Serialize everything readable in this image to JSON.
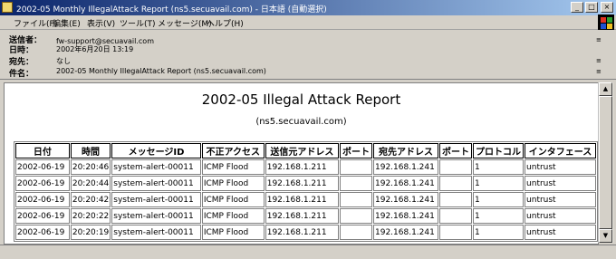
{
  "window": {
    "title": "2002-05 Monthly IllegalAttack Report (ns5.secuavail.com) - 日本語 (自動選択)"
  },
  "menu": [
    "ファイル(F)",
    "編集(E)",
    "表示(V)",
    "ツール(T)",
    "メッセージ(M)",
    "ヘルプ(H)"
  ],
  "header": {
    "from_label": "送信者：",
    "from": "fw-support@secuavail.com",
    "date_label": "日時：",
    "date": "2002年6月20日 13:19",
    "to_label": "宛先：",
    "to": "なし",
    "subject_label": "件名：",
    "subject": "2002-05 Monthly IllegalAttack Report (ns5.secuavail.com)"
  },
  "report": {
    "title": "2002-05 Illegal Attack Report",
    "subtitle": "(ns5.secuavail.com)",
    "columns": [
      "日付",
      "時間",
      "メッセージID",
      "不正アクセス",
      "送信元アドレス",
      "ポート",
      "宛先アドレス",
      "ポート",
      "プロトコル",
      "インタフェース"
    ],
    "rows": [
      [
        "2002-06-19",
        "20:20:46",
        "system-alert-00011",
        "ICMP Flood",
        "192.168.1.211",
        "",
        "192.168.1.241",
        "",
        "1",
        "untrust"
      ],
      [
        "2002-06-19",
        "20:20:44",
        "system-alert-00011",
        "ICMP Flood",
        "192.168.1.211",
        "",
        "192.168.1.241",
        "",
        "1",
        "untrust"
      ],
      [
        "2002-06-19",
        "20:20:42",
        "system-alert-00011",
        "ICMP Flood",
        "192.168.1.211",
        "",
        "192.168.1.241",
        "",
        "1",
        "untrust"
      ],
      [
        "2002-06-19",
        "20:20:22",
        "system-alert-00011",
        "ICMP Flood",
        "192.168.1.211",
        "",
        "192.168.1.241",
        "",
        "1",
        "untrust"
      ],
      [
        "2002-06-19",
        "20:20:19",
        "system-alert-00011",
        "ICMP Flood",
        "192.168.1.211",
        "",
        "192.168.1.241",
        "",
        "1",
        "untrust"
      ]
    ]
  },
  "colors": {
    "titlebar_start": "#0a246a",
    "titlebar_end": "#a6caf0",
    "chrome": "#d4d0c8"
  }
}
